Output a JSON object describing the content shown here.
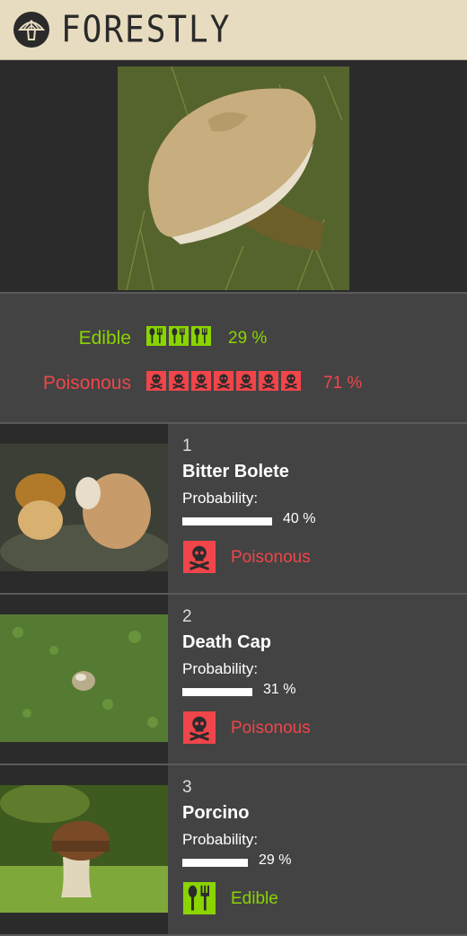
{
  "app": {
    "brand": "FORESTLY"
  },
  "summary": {
    "edible": {
      "label": "Edible",
      "percent_text": "29 %",
      "percent": 29,
      "icon_count": 3,
      "color": "#8ad400",
      "icon": "fork-spoon-icon"
    },
    "poisonous": {
      "label": "Poisonous",
      "percent_text": "71 %",
      "percent": 71,
      "icon_count": 7,
      "color": "#f0454a",
      "icon": "skull-crossbones-icon"
    }
  },
  "results": [
    {
      "rank": "1",
      "name": "Bitter Bolete",
      "probability_label": "Probability:",
      "probability": 40,
      "probability_text": "40 %",
      "classification": "Poisonous",
      "class_type": "poison"
    },
    {
      "rank": "2",
      "name": "Death Cap",
      "probability_label": "Probability:",
      "probability": 31,
      "probability_text": "31 %",
      "classification": "Poisonous",
      "class_type": "poison"
    },
    {
      "rank": "3",
      "name": "Porcino",
      "probability_label": "Probability:",
      "probability": 29,
      "probability_text": "29 %",
      "classification": "Edible",
      "class_type": "edible"
    }
  ]
}
